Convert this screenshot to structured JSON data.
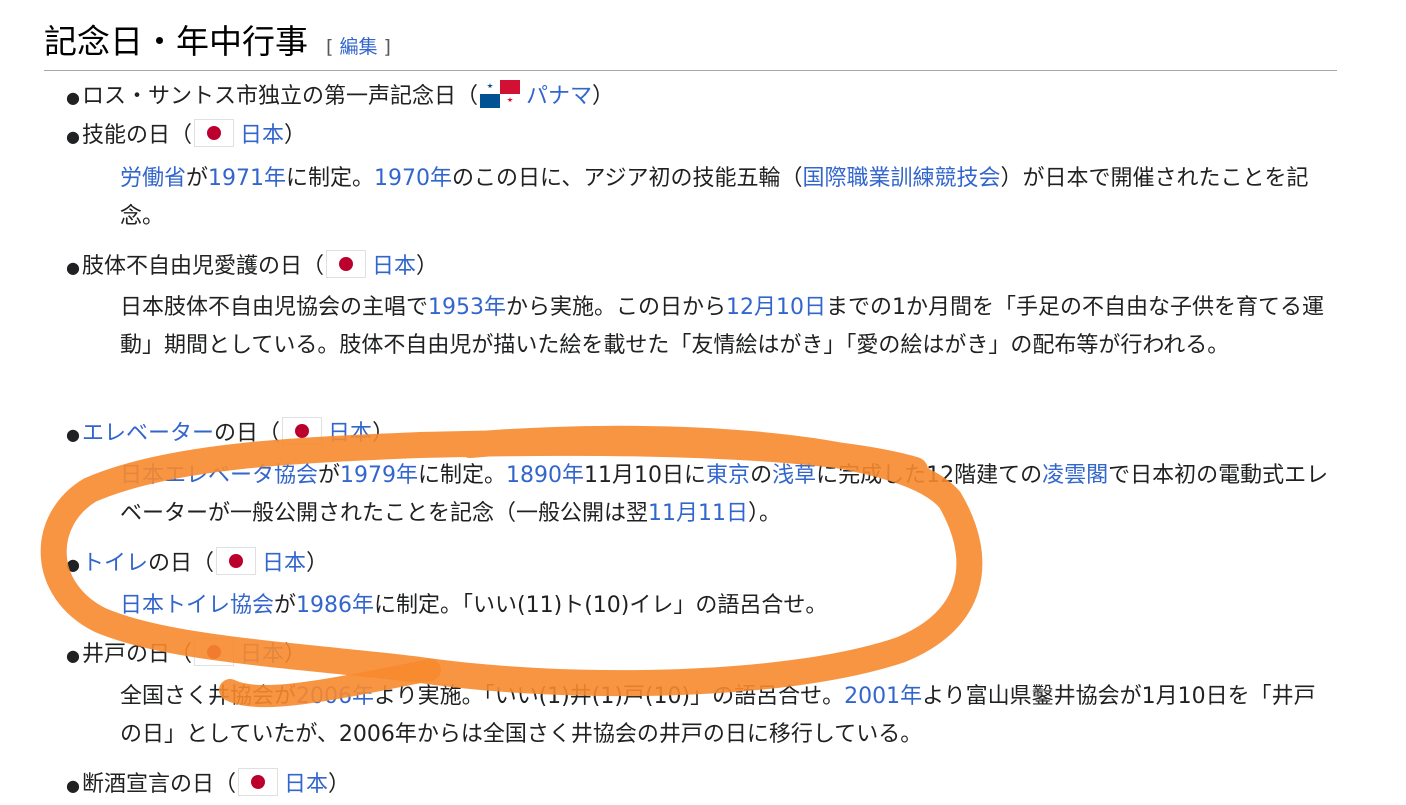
{
  "section": {
    "title": "記念日・年中行事",
    "edit_open": "[",
    "edit_label": "編集",
    "edit_close": "]"
  },
  "items": [
    {
      "name_plain": "ロス・サントス市独立の第一声記念日",
      "open": "（",
      "country": "パナマ",
      "close": "）"
    },
    {
      "name_plain": "技能の日",
      "open": "（",
      "country": "日本",
      "close": "）",
      "desc": [
        {
          "l": "労働省"
        },
        {
          "t": "が"
        },
        {
          "l": "1971年"
        },
        {
          "t": "に制定。"
        },
        {
          "l": "1970年"
        },
        {
          "t": "のこの日に、アジア初の技能五輪（"
        },
        {
          "l": "国際職業訓練競技会"
        },
        {
          "t": "）が日本で開催されたことを記念。"
        }
      ]
    },
    {
      "name_plain": "肢体不自由児愛護の日",
      "open": "（",
      "country": "日本",
      "close": "）",
      "desc": [
        {
          "t": "日本肢体不自由児協会の主唱で"
        },
        {
          "l": "1953年"
        },
        {
          "t": "から実施。この日から"
        },
        {
          "l": "12月10日"
        },
        {
          "t": "までの1か月間を「手足の不自由な子供を育てる運動」期間としている。肢体不自由児が描いた絵を載せた「友情絵はがき」「愛の絵はがき」の配布等が行われる。"
        }
      ]
    },
    {
      "name_link": "エレベーター",
      "name_rest": "の日",
      "open": "（",
      "country": "日本",
      "close": "）",
      "desc": [
        {
          "l": "日本エレベータ協会"
        },
        {
          "t": "が"
        },
        {
          "l": "1979年"
        },
        {
          "t": "に制定。"
        },
        {
          "l": "1890年"
        },
        {
          "t": "11月10日に"
        },
        {
          "l": "東京"
        },
        {
          "t": "の"
        },
        {
          "l": "浅草"
        },
        {
          "t": "に完成した12階建ての"
        },
        {
          "l": "凌雲閣"
        },
        {
          "t": "で日本初の電動式エレベーターが一般公開されたことを記念（一般公開は翌"
        },
        {
          "l": "11月11日"
        },
        {
          "t": "）。"
        }
      ]
    },
    {
      "name_link": "トイレ",
      "name_rest": "の日",
      "open": "（",
      "country": "日本",
      "close": "）",
      "desc": [
        {
          "l": "日本トイレ協会"
        },
        {
          "t": "が"
        },
        {
          "l": "1986年"
        },
        {
          "t": "に制定。「いい(11)ト(10)イレ」の語呂合せ。"
        }
      ]
    },
    {
      "name_plain": "井戸の日",
      "open": "（",
      "country": "日本",
      "close": "）",
      "desc": [
        {
          "t": "全国さく井協会が"
        },
        {
          "l": "2006年"
        },
        {
          "t": "より実施。「いい(1)井(1)戸(10)」の語呂合せ。"
        },
        {
          "l": "2001年"
        },
        {
          "t": "より富山県鑿井協会が1月10日を「井戸の日」としていたが、2006年からは全国さく井協会の井戸の日に移行している。"
        }
      ]
    },
    {
      "name_plain": "断酒宣言の日",
      "open": "（",
      "country": "日本",
      "close": "）"
    }
  ],
  "colors": {
    "link": "#3366cc",
    "text": "#202122",
    "annotation": "#f7892f"
  }
}
